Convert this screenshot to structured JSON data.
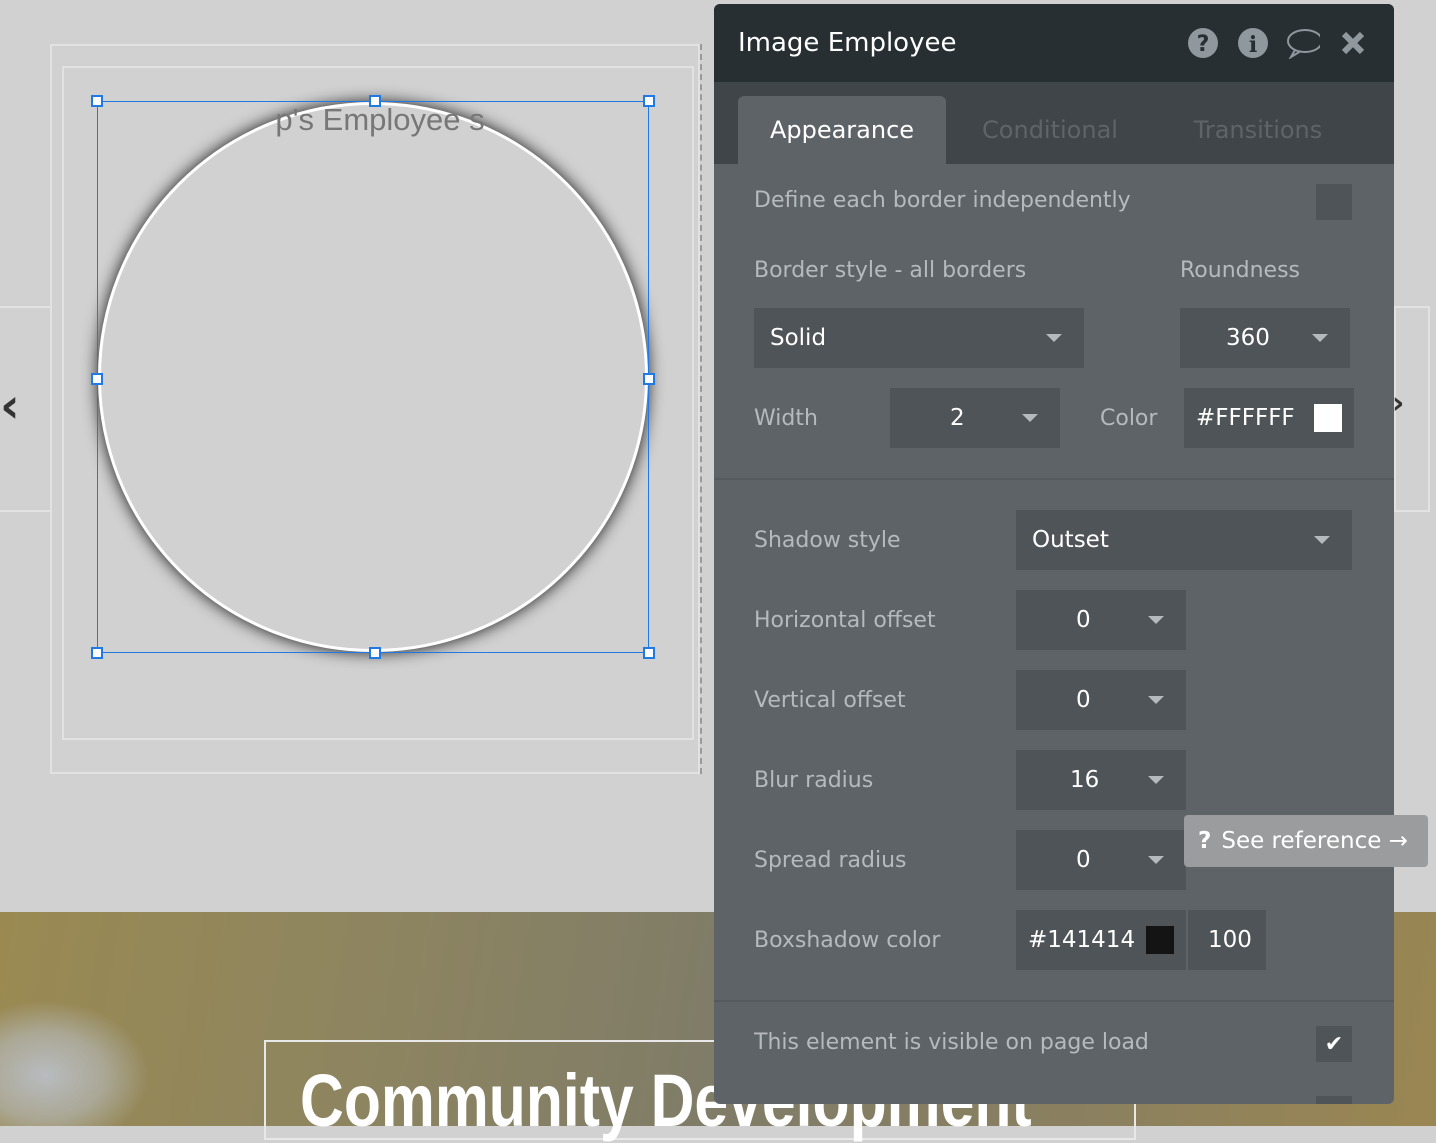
{
  "canvas": {
    "circle_text": "p's Employee s",
    "hero_title": "Community Development",
    "prev_arrow": "‹",
    "next_arrow": "›"
  },
  "panel": {
    "title": "Image Employee",
    "icons": [
      "help-icon",
      "info-icon",
      "comment-icon",
      "close-icon"
    ],
    "tabs": [
      {
        "label": "Appearance",
        "active": true
      },
      {
        "label": "Conditional"
      },
      {
        "label": "Transitions"
      }
    ],
    "define_border_label": "Define each border independently",
    "border_style_label": "Border style - all borders",
    "border_style_value": "Solid",
    "roundness_label": "Roundness",
    "roundness_value": "360",
    "width_label": "Width",
    "width_value": "2",
    "color_label": "Color",
    "color_value": "#FFFFFF",
    "shadow_style_label": "Shadow style",
    "shadow_style_value": "Outset",
    "h_offset_label": "Horizontal offset",
    "h_offset_value": "0",
    "v_offset_label": "Vertical offset",
    "v_offset_value": "0",
    "blur_label": "Blur radius",
    "blur_value": "16",
    "spread_label": "Spread radius",
    "spread_value": "0",
    "shadow_color_label": "Boxshadow color",
    "shadow_color_value": "#141414",
    "shadow_opacity": "100",
    "visible_label": "This element is visible on page load",
    "visible_checked": true
  },
  "tooltip": {
    "icon": "?",
    "label": "See reference →"
  },
  "colors": {
    "selection": "#1e7be6",
    "panel_bg": "#5e6367",
    "header_bg": "#282f33"
  }
}
